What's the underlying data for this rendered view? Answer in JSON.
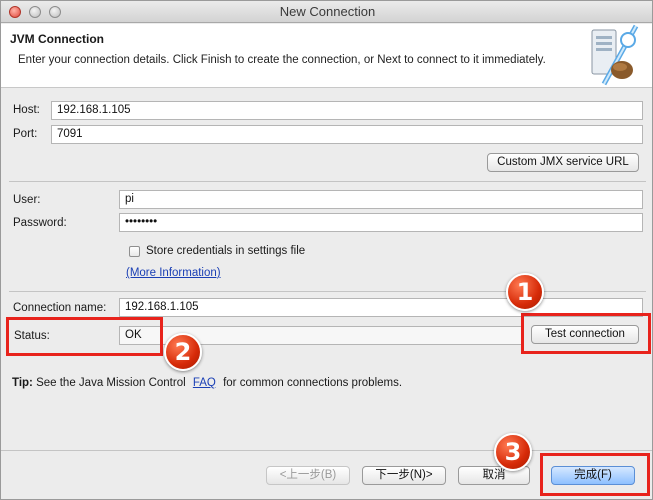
{
  "window": {
    "title": "New Connection"
  },
  "header": {
    "title": "JVM Connection",
    "description": "Enter your connection details. Click Finish to create the connection, or Next to connect to it immediately."
  },
  "form": {
    "host_label": "Host:",
    "host_value": "192.168.1.105",
    "port_label": "Port:",
    "port_value": "7091",
    "custom_jmx_button": "Custom JMX service URL",
    "user_label": "User:",
    "user_value": "pi",
    "password_label": "Password:",
    "password_value": "••••••••",
    "store_credentials_label": "Store credentials in settings file",
    "store_credentials_checked": false,
    "more_info_link": "(More Information)",
    "connection_name_label": "Connection name:",
    "connection_name_value": "192.168.1.105",
    "status_label": "Status:",
    "status_value": "OK",
    "test_connection_button": "Test connection"
  },
  "tip": {
    "prefix": "Tip:",
    "text": "See the Java Mission Control",
    "link": "FAQ",
    "suffix": "for common connections problems."
  },
  "footer": {
    "back_button": "<上一步(B)",
    "next_button": "下一步(N)>",
    "cancel_button": "取消",
    "finish_button": "完成(F)"
  },
  "annotations": {
    "badge_1": "1",
    "badge_2": "2",
    "badge_3": "3",
    "color": "#e8231c"
  }
}
